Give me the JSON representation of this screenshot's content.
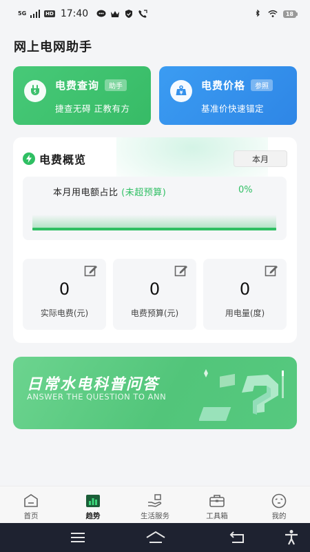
{
  "status": {
    "signal": "5G",
    "hd": "HD",
    "time": "17:40",
    "battery": "18"
  },
  "page": {
    "title": "网上电网助手"
  },
  "cards": [
    {
      "title": "电费查询",
      "tag": "助手",
      "subtitle": "捷查无碍 正教有方",
      "color": "#3cc06c"
    },
    {
      "title": "电费价格",
      "tag": "参照",
      "subtitle": "基准价快速锚定",
      "color": "#3491ec"
    }
  ],
  "overview": {
    "title": "电费概览",
    "period_button": "本月",
    "usage_label": "本月用电额占比",
    "usage_status": "(未超预算)",
    "usage_percent": "0%",
    "usage_fraction": 0,
    "stats": [
      {
        "value": "0",
        "label": "实际电费(元)"
      },
      {
        "value": "0",
        "label": "电费预算(元)"
      },
      {
        "value": "0",
        "label": "用电量(度)"
      }
    ]
  },
  "banner": {
    "title": "日常水电科普问答",
    "subtitle": "ANSWER THE QUESTION TO ANN"
  },
  "tabs": [
    {
      "label": "首页",
      "icon": "home-icon"
    },
    {
      "label": "趋势",
      "icon": "trend-chart-icon",
      "active": true
    },
    {
      "label": "生活服务",
      "icon": "hand-service-icon"
    },
    {
      "label": "工具箱",
      "icon": "toolbox-icon"
    },
    {
      "label": "我的",
      "icon": "profile-face-icon"
    }
  ],
  "colors": {
    "accent_green": "#2fbf63",
    "accent_blue": "#3491ec",
    "nav_bg": "#1e2230"
  }
}
